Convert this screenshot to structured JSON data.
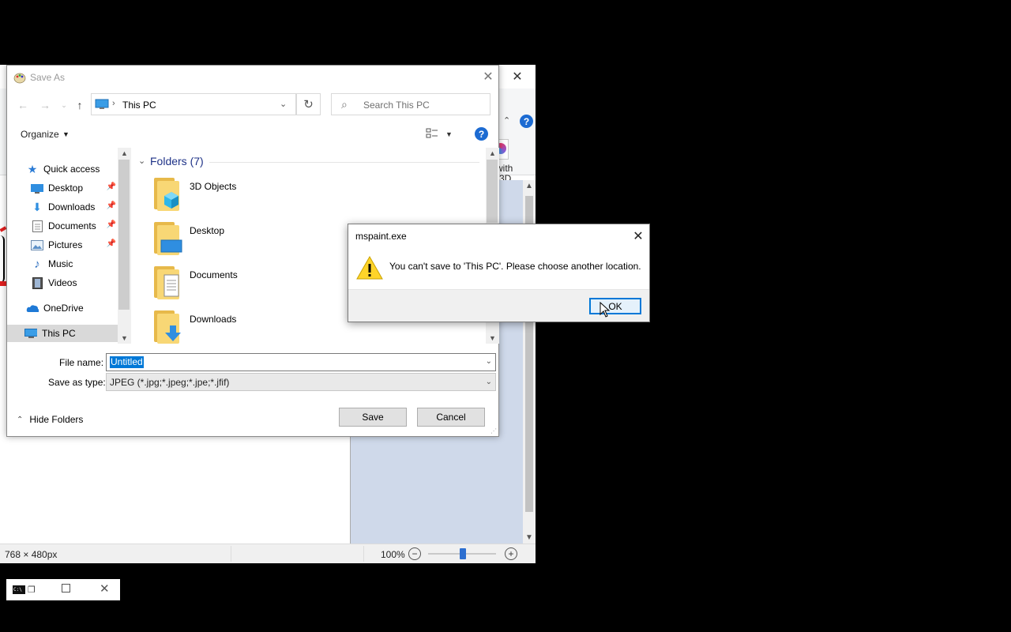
{
  "paint": {
    "status": {
      "dimensions": "768 × 480px",
      "zoom": "100%",
      "zoom_level": 1.0
    },
    "paint3d_label_1": "with",
    "paint3d_label_2": "3D",
    "help": "?"
  },
  "save_as": {
    "title": "Save As",
    "address": {
      "current": "This PC"
    },
    "search": {
      "placeholder": "Search This PC"
    },
    "toolbar": {
      "organize": "Organize",
      "help": "?"
    },
    "nav": [
      {
        "label": "Quick access"
      },
      {
        "label": "Desktop"
      },
      {
        "label": "Downloads"
      },
      {
        "label": "Documents"
      },
      {
        "label": "Pictures"
      },
      {
        "label": "Music"
      },
      {
        "label": "Videos"
      },
      {
        "label": "OneDrive"
      },
      {
        "label": "This PC"
      }
    ],
    "folders_header": "Folders (7)",
    "folders": [
      {
        "label": "3D Objects"
      },
      {
        "label": "Desktop"
      },
      {
        "label": "Documents"
      },
      {
        "label": "Downloads"
      }
    ],
    "file_name": {
      "label": "File name:",
      "value": "Untitled"
    },
    "save_type": {
      "label": "Save as type:",
      "value": "JPEG (*.jpg;*.jpeg;*.jpe;*.jfif)"
    },
    "hide_folders": "Hide Folders",
    "save_button": "Save",
    "cancel_button": "Cancel"
  },
  "alert": {
    "title": "mspaint.exe",
    "message": "You can't save to 'This PC'. Please choose another location.",
    "ok_button": "OK"
  },
  "colors": {
    "accent": "#0078d7",
    "folder": "#f8d775",
    "help": "#1c6bd2"
  }
}
